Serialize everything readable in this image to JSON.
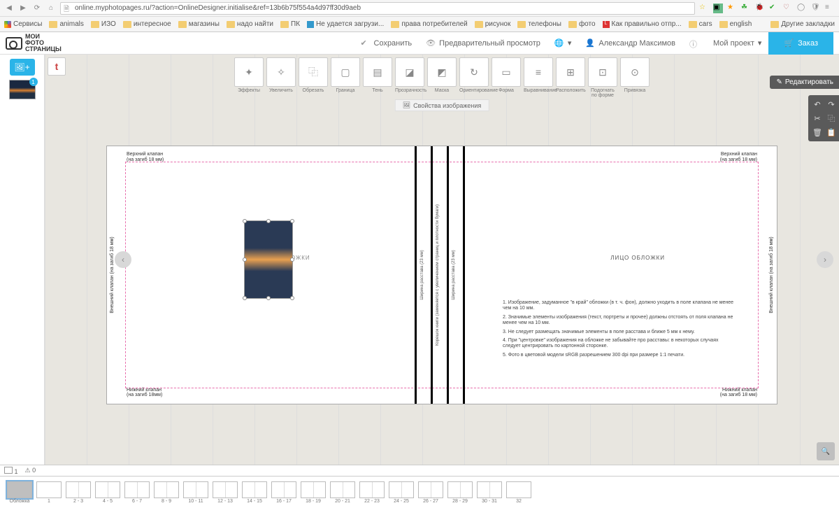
{
  "browser": {
    "url": "online.myphotopages.ru/?action=OnlineDesigner.initialise&ref=13b6b75f554a4d97ff30d9aeb",
    "bookmarks": [
      "Сервисы",
      "animals",
      "ИЗО",
      "интересное",
      "магазины",
      "надо найти",
      "ПК",
      "Не удается загрузи...",
      "права потребителей",
      "рисунок",
      "телефоны",
      "фото",
      "Как правильно отпр...",
      "cars",
      "english"
    ],
    "other_bookmarks": "Другие закладки"
  },
  "logo": {
    "l1": "МОИ",
    "l2": "ФОТО",
    "l3": "СТРАНИЦЫ"
  },
  "header": {
    "save": "Сохранить",
    "preview": "Предварительный просмотр",
    "user": "Александр Максимов",
    "project": "Мой проект",
    "order": "Заказ"
  },
  "thumb_badge": "1",
  "toolbar": [
    "Эффекты",
    "Увеличить",
    "Обрезать",
    "Граница",
    "Тень",
    "Прозрачность",
    "Маска",
    "Ориентирование",
    "Форма",
    "Выравнивание",
    "Расположить",
    "Подогнать по форме",
    "Привязка"
  ],
  "tool_glyphs": [
    "✦",
    "✧",
    "⿻",
    "▢",
    "▤",
    "◪",
    "◩",
    "↻",
    "▭",
    "≡",
    "⊞",
    "⊡",
    "⊙"
  ],
  "sub_bar": "Свойства изображения",
  "spread": {
    "top_flap": "Верхний клапан",
    "fold18": "(на загиб 18 мм)",
    "fold18mm": "(на загиб 18мм)",
    "bottom_flap": "Нижний клапан",
    "side_flap": "Внешний клапан (на загиб 18 мм)",
    "spine1": "Ширина расстава (23 мм)",
    "spine2": "Корешок книги (заменяется с увеличением страниц и плотности бумаги)",
    "spine3": "Ширина расстава (23 мм)",
    "back": "ОБОРОТ ОБЛОЖКИ",
    "front": "ЛИЦО ОБЛОЖКИ",
    "g1": "1. Изображение, задуманное \"в край\" обложки (в т. ч. фон), должно уходить в поле клапана не менее чем на 10 мм.",
    "g2": "2. Значимые элементы изображения (текст, портреты и прочее) должны отстоять от поля клапана не менее чем на 10 мм.",
    "g3": "3. Не следует размещать значимые элементы в поле расстава и ближе 5 мм к нему.",
    "g4": "4. При \"центровке\" изображения на обложке не забывайте про расставы: в некоторых случаях следует центрировать по картонной сторонке.",
    "g5": "5. Фото в цветовой модели sRGB разрешением 300 dpi при размере 1:1 печати."
  },
  "edit": "Редактировать",
  "status": {
    "c1": "1",
    "c2": "0"
  },
  "pages": [
    {
      "label": "Обложка",
      "cover": true,
      "sel": true
    },
    {
      "label": "1"
    },
    {
      "label": "2 - 3"
    },
    {
      "label": "4 - 5"
    },
    {
      "label": "6 - 7"
    },
    {
      "label": "8 - 9"
    },
    {
      "label": "10 - 11"
    },
    {
      "label": "12 - 13"
    },
    {
      "label": "14 - 15"
    },
    {
      "label": "16 - 17"
    },
    {
      "label": "18 - 19"
    },
    {
      "label": "20 - 21"
    },
    {
      "label": "22 - 23"
    },
    {
      "label": "24 - 25"
    },
    {
      "label": "26 - 27"
    },
    {
      "label": "28 - 29"
    },
    {
      "label": "30 - 31"
    },
    {
      "label": "32"
    }
  ]
}
